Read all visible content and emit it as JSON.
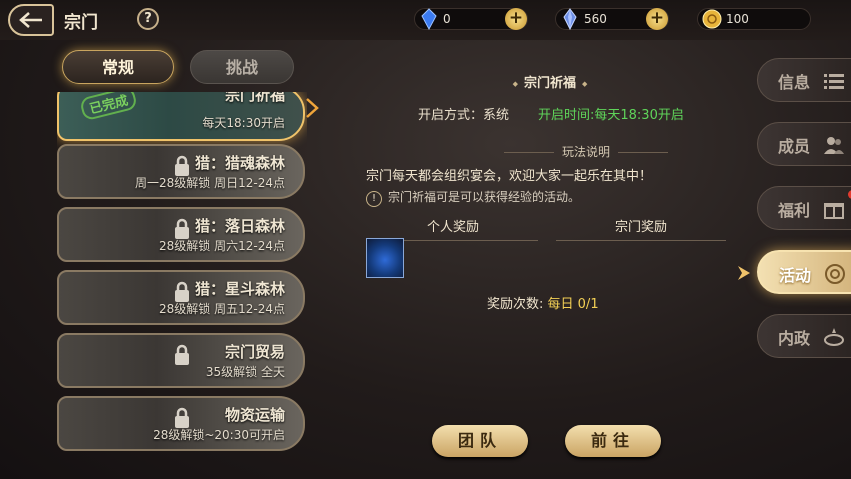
{
  "header": {
    "title": "宗门",
    "help_label": "?"
  },
  "resources": [
    {
      "icon": "blue-crystal-icon",
      "value": "0"
    },
    {
      "icon": "diamond-icon",
      "value": "560"
    },
    {
      "icon": "gold-coin-icon",
      "value": "100"
    }
  ],
  "tabs": [
    {
      "label": "常规",
      "active": true
    },
    {
      "label": "挑战",
      "active": false
    }
  ],
  "activities": [
    {
      "name": "宗门祈福",
      "sub": "每天18:30开启",
      "stamp": "已完成",
      "selected": true
    },
    {
      "name": "猎：猎魂森林",
      "sub": "周一28级解锁 周日12-24点",
      "locked": true
    },
    {
      "name": "猎：落日森林",
      "sub": "28级解锁 周六12-24点",
      "locked": true
    },
    {
      "name": "猎：星斗森林",
      "sub": "28级解锁 周五12-24点",
      "locked": true
    },
    {
      "name": "宗门贸易",
      "sub": "35级解锁 全天",
      "locked": true
    },
    {
      "name": "物资运输",
      "sub": "28级解锁~20:30可开启",
      "locked": true
    }
  ],
  "detail": {
    "title": "宗门祈福",
    "open_method_label": "开启方式：",
    "open_method_value": "系统",
    "open_time": "开启时间:每天18:30开启",
    "gameplay_head": "玩法说明",
    "desc_line1": "宗门每天都会组织宴会，欢迎大家一起乐在其中！",
    "desc_line2": "宗门祈福可是可以获得经验的活动。",
    "personal_reward": "个人奖励",
    "sect_reward": "宗门奖励",
    "reward_count_label": "奖励次数:",
    "reward_count_value": "每日 0/1"
  },
  "buttons": {
    "team": "团队",
    "go": "前往"
  },
  "side_tabs": [
    {
      "label": "信息",
      "icon": "list-icon"
    },
    {
      "label": "成员",
      "icon": "members-icon"
    },
    {
      "label": "福利",
      "icon": "gift-icon",
      "badge": true
    },
    {
      "label": "活动",
      "icon": "activity-icon",
      "active": true
    },
    {
      "label": "内政",
      "icon": "affairs-icon"
    }
  ],
  "colors": {
    "accent": "#f0c36a",
    "green": "#5fd45a",
    "yellow": "#f3d055"
  }
}
